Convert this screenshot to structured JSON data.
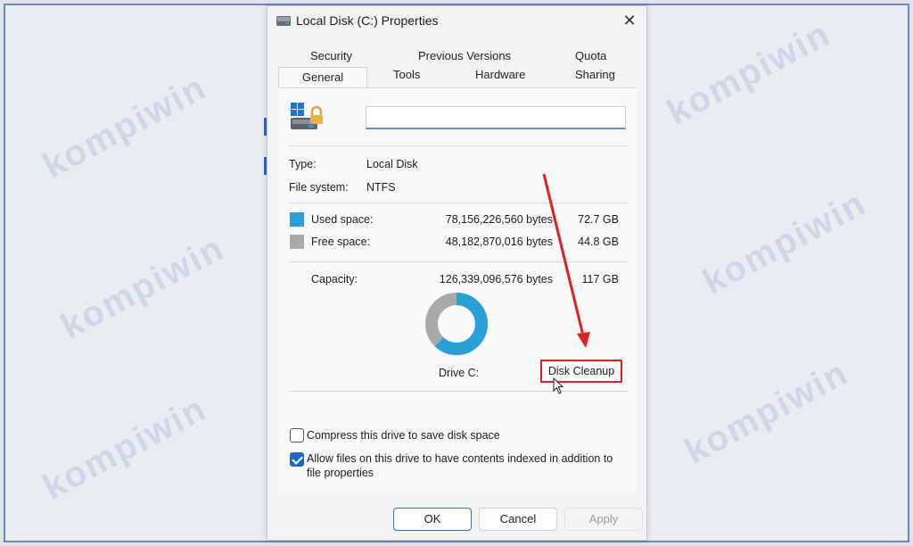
{
  "watermark": "kompiwin",
  "dialog": {
    "title": "Local Disk (C:) Properties",
    "close_glyph": "✕"
  },
  "tabs": {
    "row1": [
      "Security",
      "Previous Versions",
      "Quota"
    ],
    "row2": [
      "General",
      "Tools",
      "Hardware",
      "Sharing"
    ],
    "active": "General"
  },
  "general": {
    "name_value": "",
    "type_label": "Type:",
    "type_value": "Local Disk",
    "fs_label": "File system:",
    "fs_value": "NTFS",
    "used_label": "Used space:",
    "used_bytes": "78,156,226,560 bytes",
    "used_size": "72.7 GB",
    "free_label": "Free space:",
    "free_bytes": "48,182,870,016 bytes",
    "free_size": "44.8 GB",
    "capacity_label": "Capacity:",
    "capacity_bytes": "126,339,096,576 bytes",
    "capacity_size": "117 GB",
    "drive_label": "Drive C:",
    "cleanup_label": "Disk Cleanup",
    "used_fraction": 0.62
  },
  "options": {
    "compress_label": "Compress this drive to save disk space",
    "compress_checked": false,
    "index_label_1": "Allow files on this drive to have contents indexed in addition to",
    "index_label_2": "file properties",
    "index_checked": true
  },
  "buttons": {
    "ok": "OK",
    "cancel": "Cancel",
    "apply": "Apply"
  },
  "colors": {
    "used": "#2aa0d8",
    "free": "#a9a9a9",
    "highlight": "#e02020",
    "accent": "#1f66c7"
  }
}
